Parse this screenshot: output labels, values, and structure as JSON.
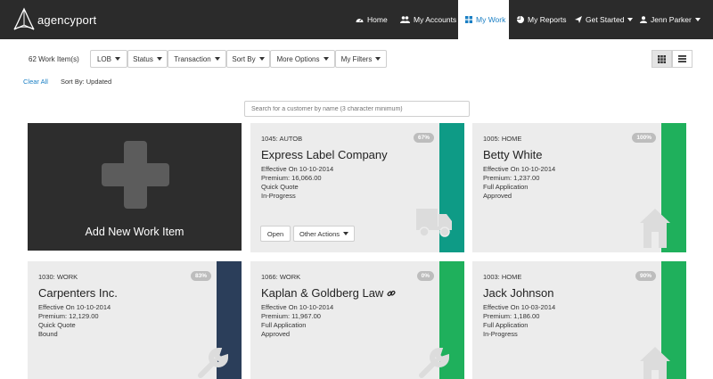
{
  "brand": {
    "logo_text": "agencyport"
  },
  "nav": {
    "home": "Home",
    "accounts": "My Accounts",
    "work": "My Work",
    "reports": "My Reports",
    "get_started": "Get Started",
    "user": "Jenn Parker"
  },
  "filters": {
    "count": "62 Work Item(s)",
    "lob": "LOB",
    "status": "Status",
    "transaction": "Transaction",
    "sort_by": "Sort By",
    "more_options": "More Options",
    "my_filters": "My Filters",
    "clear_all": "Clear All",
    "sort_label": "Sort By: Updated"
  },
  "search": {
    "placeholder": "Search for a customer by name (3 character minimum)"
  },
  "add_card": {
    "label": "Add New Work Item"
  },
  "cards": [
    {
      "header": "1045: AUTOB",
      "percent": "67%",
      "name": "Express Label Company",
      "effective": "Effective On 10-10-2014",
      "premium": "Premium: 16,066.00",
      "type": "Quick Quote",
      "status": "In-Progress",
      "stripe_color": "#0e9b86",
      "icon": "truck-icon",
      "open_label": "Open",
      "other_actions_label": "Other Actions"
    },
    {
      "header": "1005: HOME",
      "percent": "100%",
      "name": "Betty White",
      "effective": "Effective On 10-10-2014",
      "premium": "Premium: 1,237.00",
      "type": "Full Application",
      "status": "Approved",
      "stripe_color": "#1fb05c",
      "icon": "house-icon"
    },
    {
      "header": "1030: WORK",
      "percent": "83%",
      "name": "Carpenters Inc.",
      "effective": "Effective On 10-10-2014",
      "premium": "Premium: 12,129.00",
      "type": "Quick Quote",
      "status": "Bound",
      "stripe_color": "#2b3e5a",
      "icon": "wrench-icon"
    },
    {
      "header": "1066: WORK",
      "percent": "0%",
      "name": "Kaplan & Goldberg Law",
      "effective": "Effective On 10-10-2014",
      "premium": "Premium: 11,967.00",
      "type": "Full Application",
      "status": "Approved",
      "stripe_color": "#1fb05c",
      "icon": "wrench-icon"
    },
    {
      "header": "1003: HOME",
      "percent": "90%",
      "name": "Jack Johnson",
      "effective": "Effective On 10-03-2014",
      "premium": "Premium: 1,186.00",
      "type": "Full Application",
      "status": "In-Progress",
      "stripe_color": "#1fb05c",
      "icon": "house-icon"
    }
  ]
}
